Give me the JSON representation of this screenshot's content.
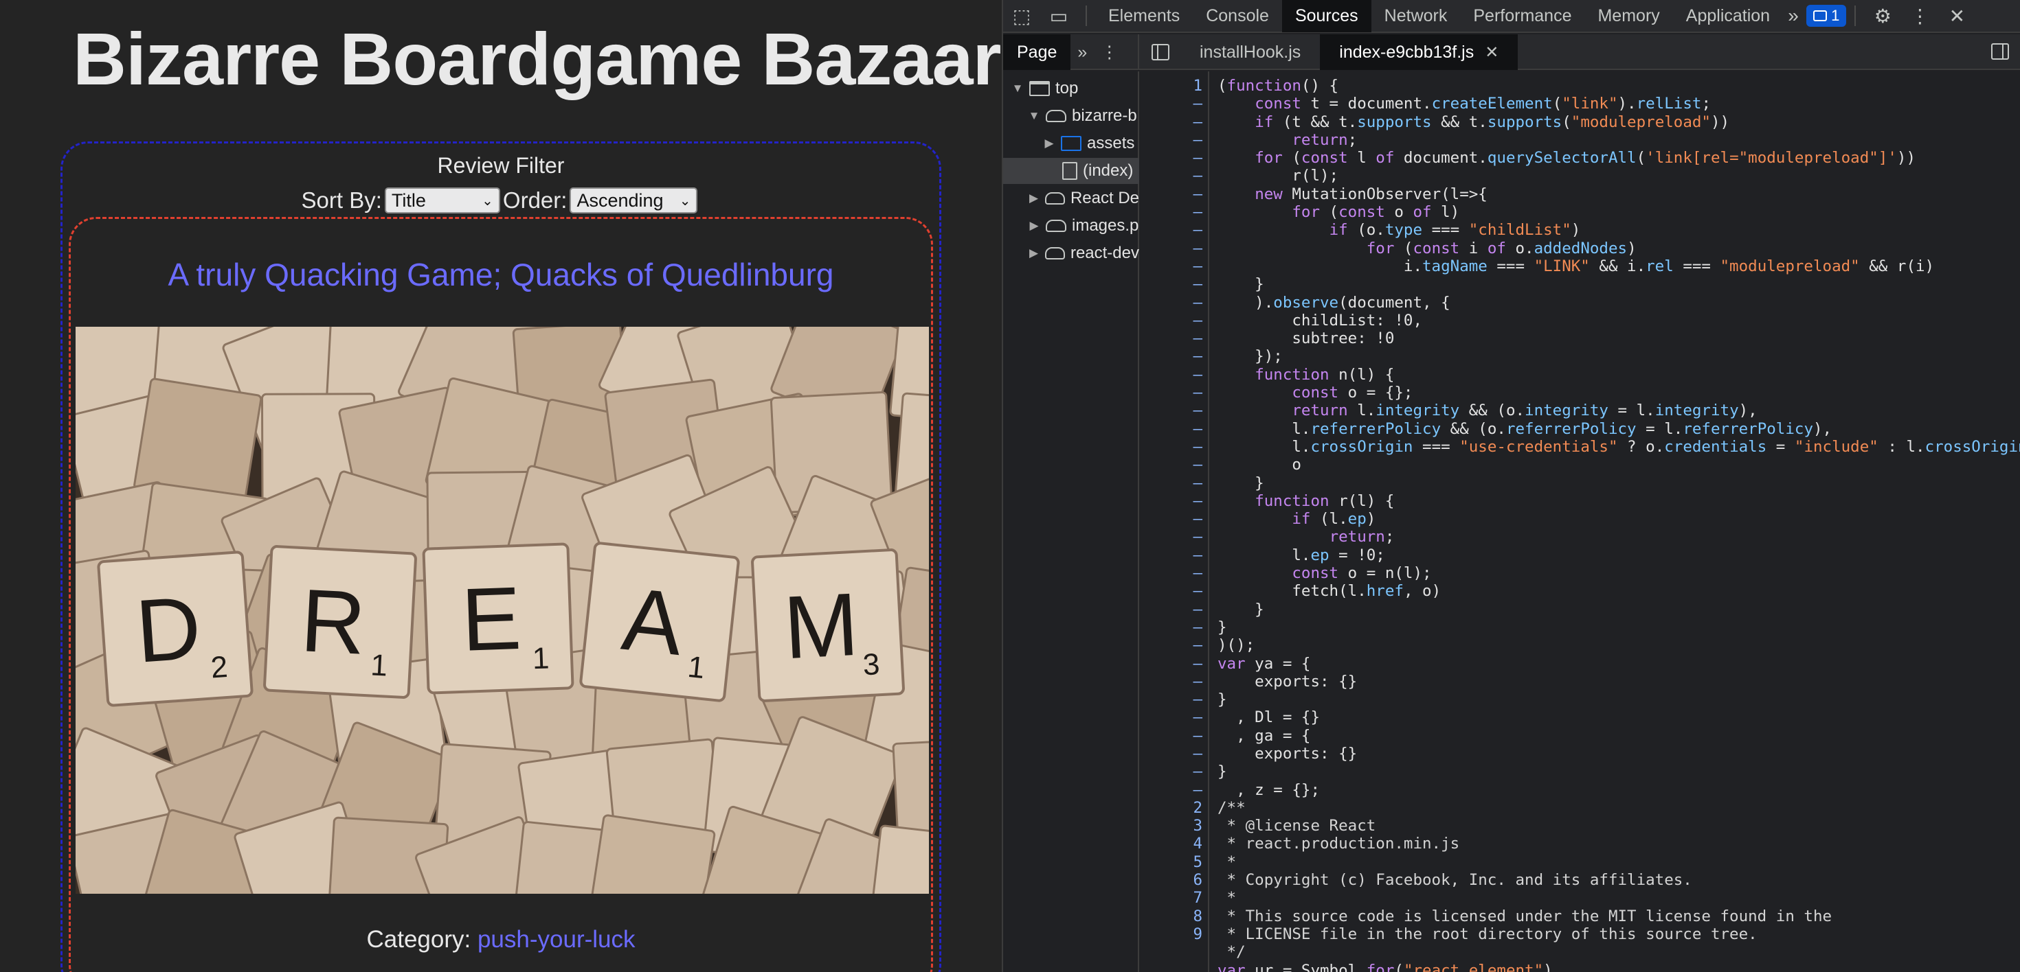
{
  "app": {
    "title": "Bizarre Boardgame Bazaar",
    "filter": {
      "title": "Review Filter",
      "sort_label": "Sort By:",
      "sort_value": "Title",
      "order_label": "Order:",
      "order_value": "Ascending"
    },
    "card": {
      "title": "A truly Quacking Game; Quacks of Quedlinburg",
      "category_label": "Category:",
      "category_value": "push-your-luck",
      "image_tiles": [
        {
          "letter": "D",
          "score": "2"
        },
        {
          "letter": "R",
          "score": "1"
        },
        {
          "letter": "E",
          "score": "1"
        },
        {
          "letter": "A",
          "score": "1"
        },
        {
          "letter": "M",
          "score": "3"
        }
      ]
    }
  },
  "devtools": {
    "tabs": [
      "Elements",
      "Console",
      "Sources",
      "Network",
      "Performance",
      "Memory",
      "Application"
    ],
    "active_tab": "Sources",
    "issues_count": "1",
    "navigator_tab": "Page",
    "file_tabs": [
      {
        "name": "installHook.js"
      },
      {
        "name": "index-e9cbb13f.js"
      }
    ],
    "tree": [
      {
        "label": "top"
      },
      {
        "label": "bizarre-b"
      },
      {
        "label": "assets"
      },
      {
        "label": "(index)"
      },
      {
        "label": "React De"
      },
      {
        "label": "images.p"
      },
      {
        "label": "react-dev"
      }
    ],
    "gutter": [
      "1",
      "–",
      "–",
      "–",
      "–",
      "–",
      "–",
      "–",
      "–",
      "–",
      "–",
      "–",
      "–",
      "–",
      "–",
      "–",
      "–",
      "–",
      "–",
      "–",
      "–",
      "–",
      "–",
      "–",
      "–",
      "–",
      "–",
      "–",
      "–",
      "–",
      "–",
      "–",
      "–",
      "–",
      "–",
      "–",
      "–",
      "–",
      "–",
      "–",
      "2",
      "3",
      "4",
      "5",
      "6",
      "7",
      "8",
      "9"
    ],
    "code_lines": [
      "(function() {",
      "    const t = document.createElement(\"link\").relList;",
      "    if (t && t.supports && t.supports(\"modulepreload\"))",
      "        return;",
      "    for (const l of document.querySelectorAll('link[rel=\"modulepreload\"]'))",
      "        r(l);",
      "    new MutationObserver(l=>{",
      "        for (const o of l)",
      "            if (o.type === \"childList\")",
      "                for (const i of o.addedNodes)",
      "                    i.tagName === \"LINK\" && i.rel === \"modulepreload\" && r(i)",
      "    }",
      "    ).observe(document, {",
      "        childList: !0,",
      "        subtree: !0",
      "    });",
      "    function n(l) {",
      "        const o = {};",
      "        return l.integrity && (o.integrity = l.integrity),",
      "        l.referrerPolicy && (o.referrerPolicy = l.referrerPolicy),",
      "        l.crossOrigin === \"use-credentials\" ? o.credentials = \"include\" : l.crossOrigin ==",
      "        o",
      "    }",
      "    function r(l) {",
      "        if (l.ep)",
      "            return;",
      "        l.ep = !0;",
      "        const o = n(l);",
      "        fetch(l.href, o)",
      "    }",
      "}",
      ")();",
      "var ya = {",
      "    exports: {}",
      "}",
      "  , Dl = {}",
      "  , ga = {",
      "    exports: {}",
      "}",
      "  , z = {};",
      "/**",
      " * @license React",
      " * react.production.min.js",
      " *",
      " * Copyright (c) Facebook, Inc. and its affiliates.",
      " *",
      " * This source code is licensed under the MIT license found in the",
      " * LICENSE file in the root directory of this source tree.",
      " */",
      "var ur = Symbol.for(\"react.element\")"
    ]
  }
}
